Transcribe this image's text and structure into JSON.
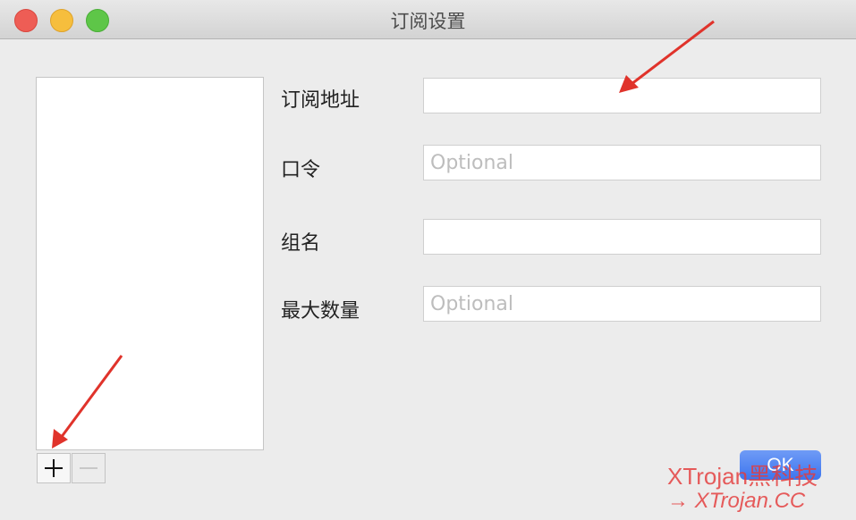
{
  "window": {
    "title": "订阅设置"
  },
  "form": {
    "fields": [
      {
        "label": "订阅地址",
        "value": "",
        "placeholder": ""
      },
      {
        "label": "口令",
        "value": "",
        "placeholder": "Optional"
      },
      {
        "label": "组名",
        "value": "",
        "placeholder": ""
      },
      {
        "label": "最大数量",
        "value": "",
        "placeholder": "Optional"
      }
    ]
  },
  "list": {
    "add_label": "+",
    "remove_label": "−"
  },
  "buttons": {
    "ok_label": "OK"
  },
  "watermark": {
    "line1": "XTrojan黑科技",
    "line2": "→ XTrojan.CC"
  },
  "annotation_color": "#e0332b"
}
